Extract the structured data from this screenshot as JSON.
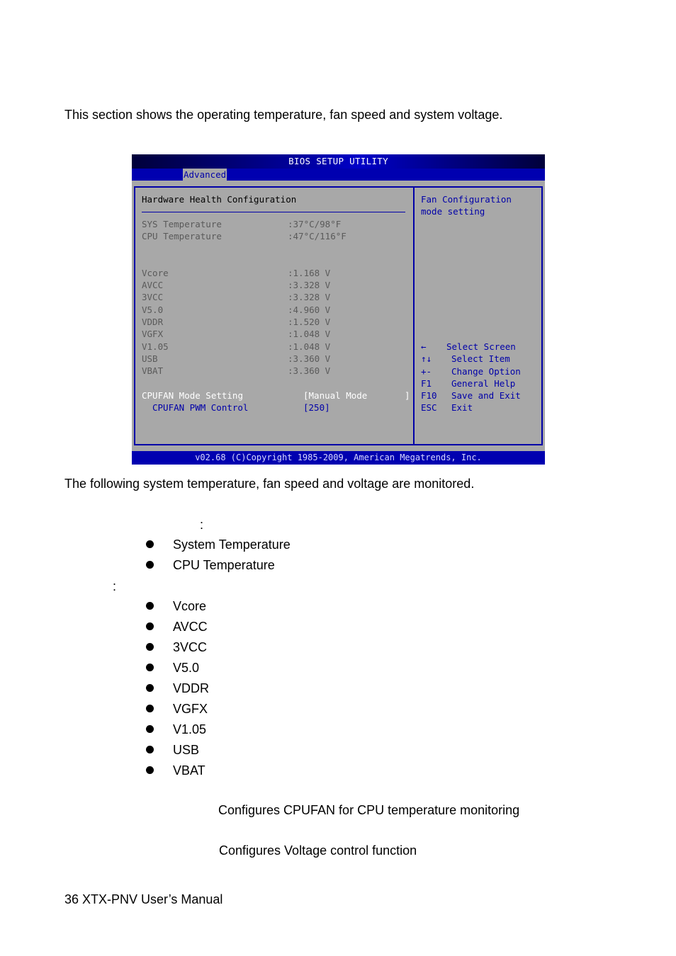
{
  "document": {
    "intro": "This section shows the operating temperature, fan speed and system voltage.",
    "monitored_intro": "The following system temperature, fan speed and voltage are monitored.",
    "temperature_heading_colon": ":",
    "temperature_items": [
      "System Temperature",
      "CPU Temperature"
    ],
    "voltage_heading_colon": ":",
    "voltage_items": [
      "Vcore",
      "AVCC",
      "3VCC",
      "V5.0",
      "VDDR",
      "VGFX",
      "V1.05",
      "USB",
      "VBAT"
    ],
    "cpufan_description": "Configures CPUFAN for CPU temperature monitoring",
    "voltage_description": "Configures Voltage control function",
    "footer": "36 XTX-PNV User’s Manual"
  },
  "bios": {
    "title": "BIOS SETUP UTILITY",
    "active_tab": "Advanced",
    "section_title": "Hardware Health Configuration",
    "temperatures": [
      {
        "label": "SYS Temperature",
        "value": ":37°C/98°F"
      },
      {
        "label": "CPU Temperature",
        "value": ":47°C/116°F"
      }
    ],
    "voltages": [
      {
        "label": "Vcore",
        "value": ":1.168 V"
      },
      {
        "label": "AVCC",
        "value": ":3.328 V"
      },
      {
        "label": "3VCC",
        "value": ":3.328 V"
      },
      {
        "label": "V5.0",
        "value": ":4.960 V"
      },
      {
        "label": "VDDR",
        "value": ":1.520 V"
      },
      {
        "label": "VGFX",
        "value": ":1.048 V"
      },
      {
        "label": "V1.05",
        "value": ":1.048 V"
      },
      {
        "label": "USB",
        "value": ":3.360 V"
      },
      {
        "label": "VBAT",
        "value": ":3.360 V"
      }
    ],
    "settings": [
      {
        "label": "CPUFAN Mode Setting",
        "value": "[Manual Mode       ]"
      },
      {
        "label": "CPUFAN PWM Control",
        "value": "[250]"
      }
    ],
    "help_text": [
      "Fan Configuration",
      "mode setting"
    ],
    "keys": [
      {
        "key": "←",
        "desc": "Select Screen"
      },
      {
        "key": "↑↓",
        "desc": "Select Item"
      },
      {
        "key": "+-",
        "desc": "Change Option"
      },
      {
        "key": "F1",
        "desc": "General Help"
      },
      {
        "key": "F10",
        "desc": "Save and Exit"
      },
      {
        "key": "ESC",
        "desc": "Exit"
      }
    ],
    "footer": "v02.68 (C)Copyright 1985-2009, American Megatrends, Inc."
  }
}
